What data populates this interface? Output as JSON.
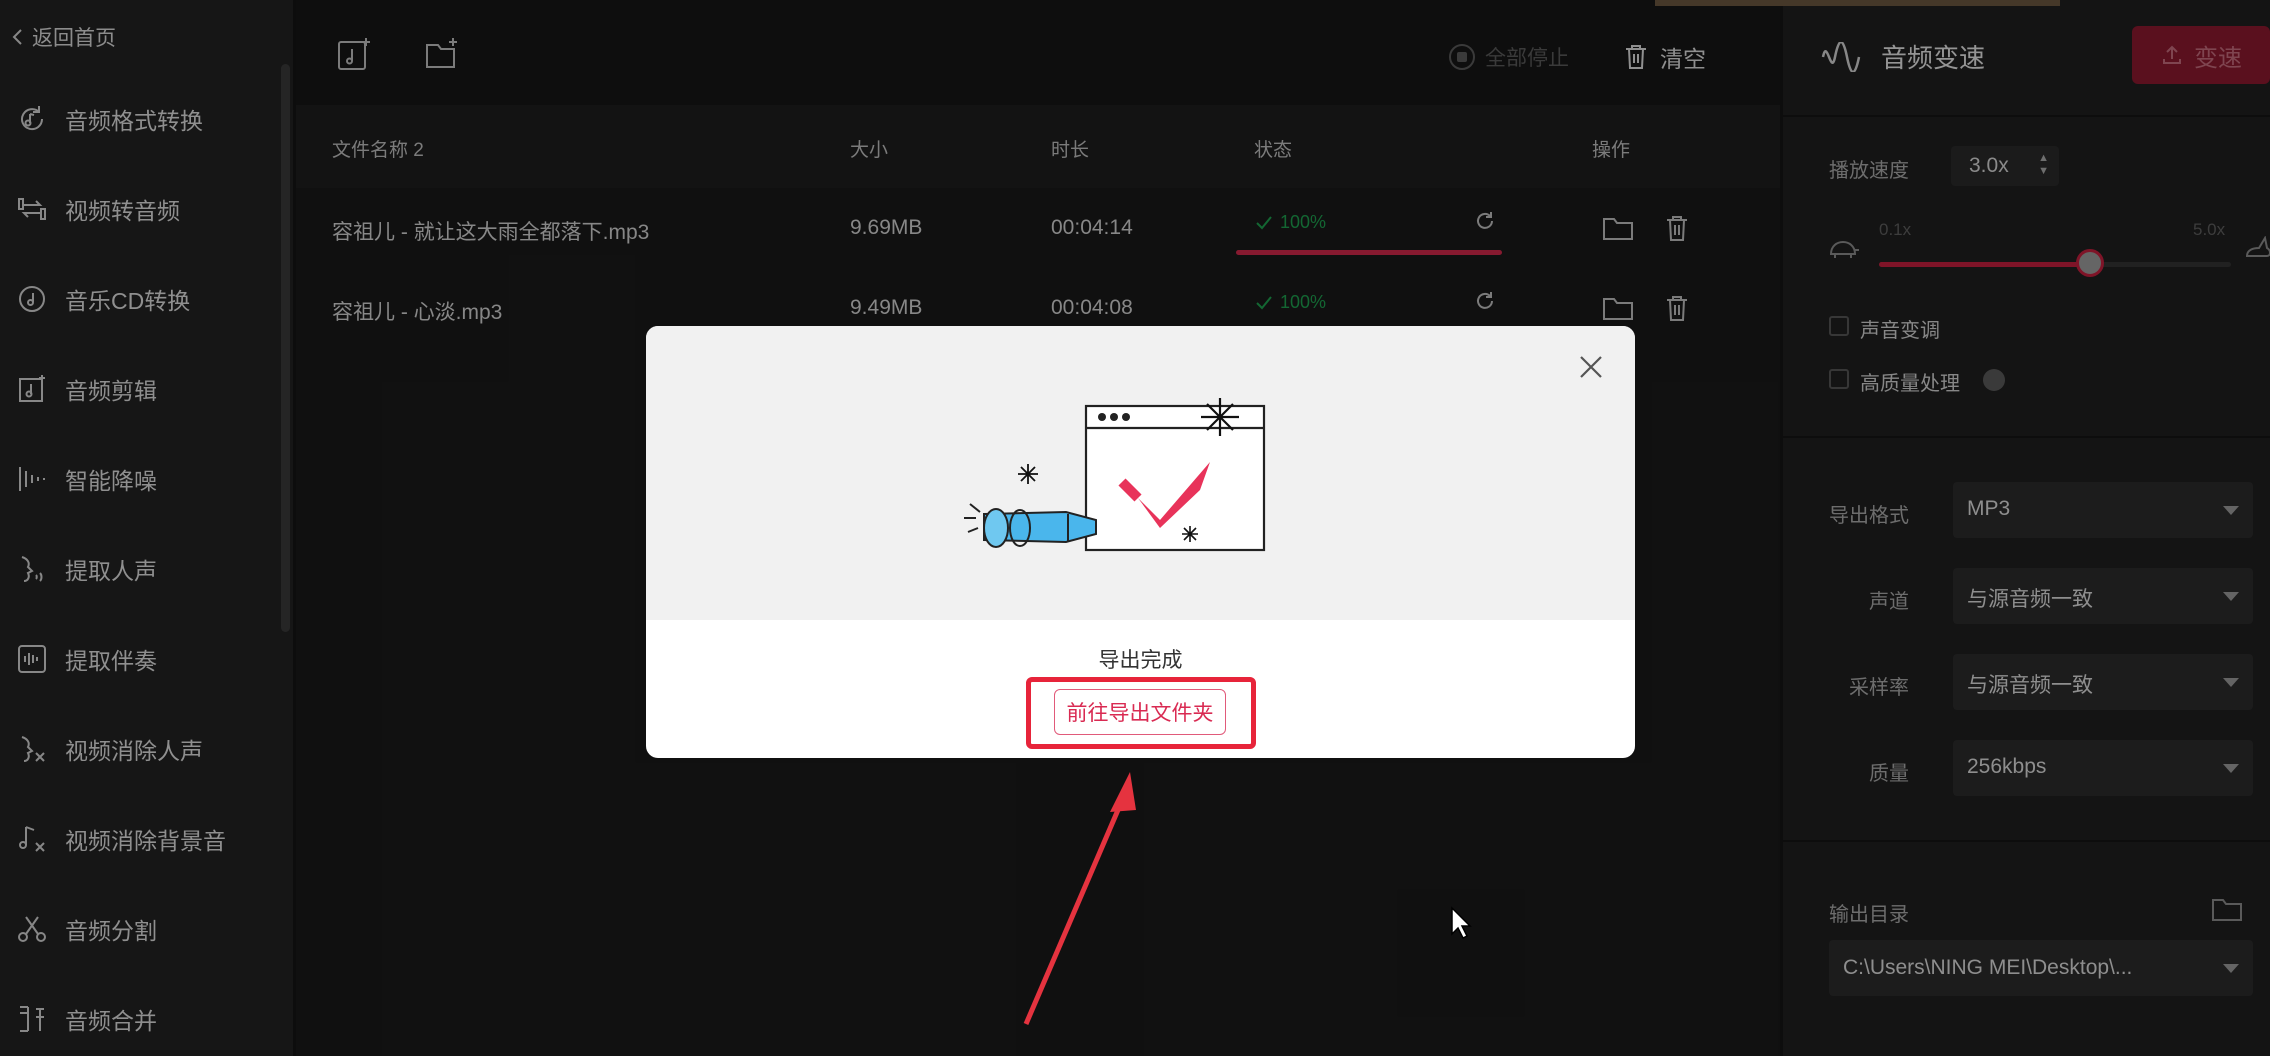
{
  "sidebar": {
    "back_label": "返回首页",
    "items": [
      {
        "label": "音频格式转换",
        "icon": "audio-convert-icon"
      },
      {
        "label": "视频转音频",
        "icon": "video-to-audio-icon"
      },
      {
        "label": "音乐CD转换",
        "icon": "cd-icon"
      },
      {
        "label": "音频剪辑",
        "icon": "audio-cut-icon"
      },
      {
        "label": "智能降噪",
        "icon": "noise-reduction-icon"
      },
      {
        "label": "提取人声",
        "icon": "extract-vocal-icon"
      },
      {
        "label": "提取伴奏",
        "icon": "extract-accompaniment-icon"
      },
      {
        "label": "视频消除人声",
        "icon": "remove-vocal-icon"
      },
      {
        "label": "视频消除背景音",
        "icon": "remove-bgm-icon"
      },
      {
        "label": "音频分割",
        "icon": "scissors-icon"
      },
      {
        "label": "音频合并",
        "icon": "merge-icon"
      }
    ]
  },
  "toolbar": {
    "stop_all_label": "全部停止",
    "clear_label": "清空"
  },
  "table": {
    "headers": {
      "name": "文件名称 2",
      "size": "大小",
      "duration": "时长",
      "status": "状态",
      "ops": "操作"
    },
    "rows": [
      {
        "name": "容祖儿 - 就让这大雨全都落下.mp3",
        "size": "9.69MB",
        "duration": "00:04:14",
        "progress": "100%",
        "progress_value": 1.0
      },
      {
        "name": "容祖儿 - 心淡.mp3",
        "size": "9.49MB",
        "duration": "00:04:08",
        "progress": "100%",
        "progress_value": 1.0
      }
    ]
  },
  "right_panel": {
    "title": "音频变速",
    "action_button": "变速",
    "speed_label": "播放速度",
    "speed_value": "3.0x",
    "slider_min": "0.1x",
    "slider_max": "5.0x",
    "slider_value": 0.6,
    "pitch_label": "声音变调",
    "hq_label": "高质量处理",
    "export_format_label": "导出格式",
    "export_format_value": "MP3",
    "channel_label": "声道",
    "channel_value": "与源音频一致",
    "sample_rate_label": "采样率",
    "sample_rate_value": "与源音频一致",
    "quality_label": "质量",
    "quality_value": "256kbps",
    "output_dir_label": "输出目录",
    "output_dir_value": "C:\\Users\\NING MEI\\Desktop\\..."
  },
  "modal": {
    "message": "导出完成",
    "button_label": "前往导出文件夹"
  },
  "colors": {
    "accent": "#d92a52",
    "highlight": "#e7243a",
    "success": "#1e9e4e"
  }
}
